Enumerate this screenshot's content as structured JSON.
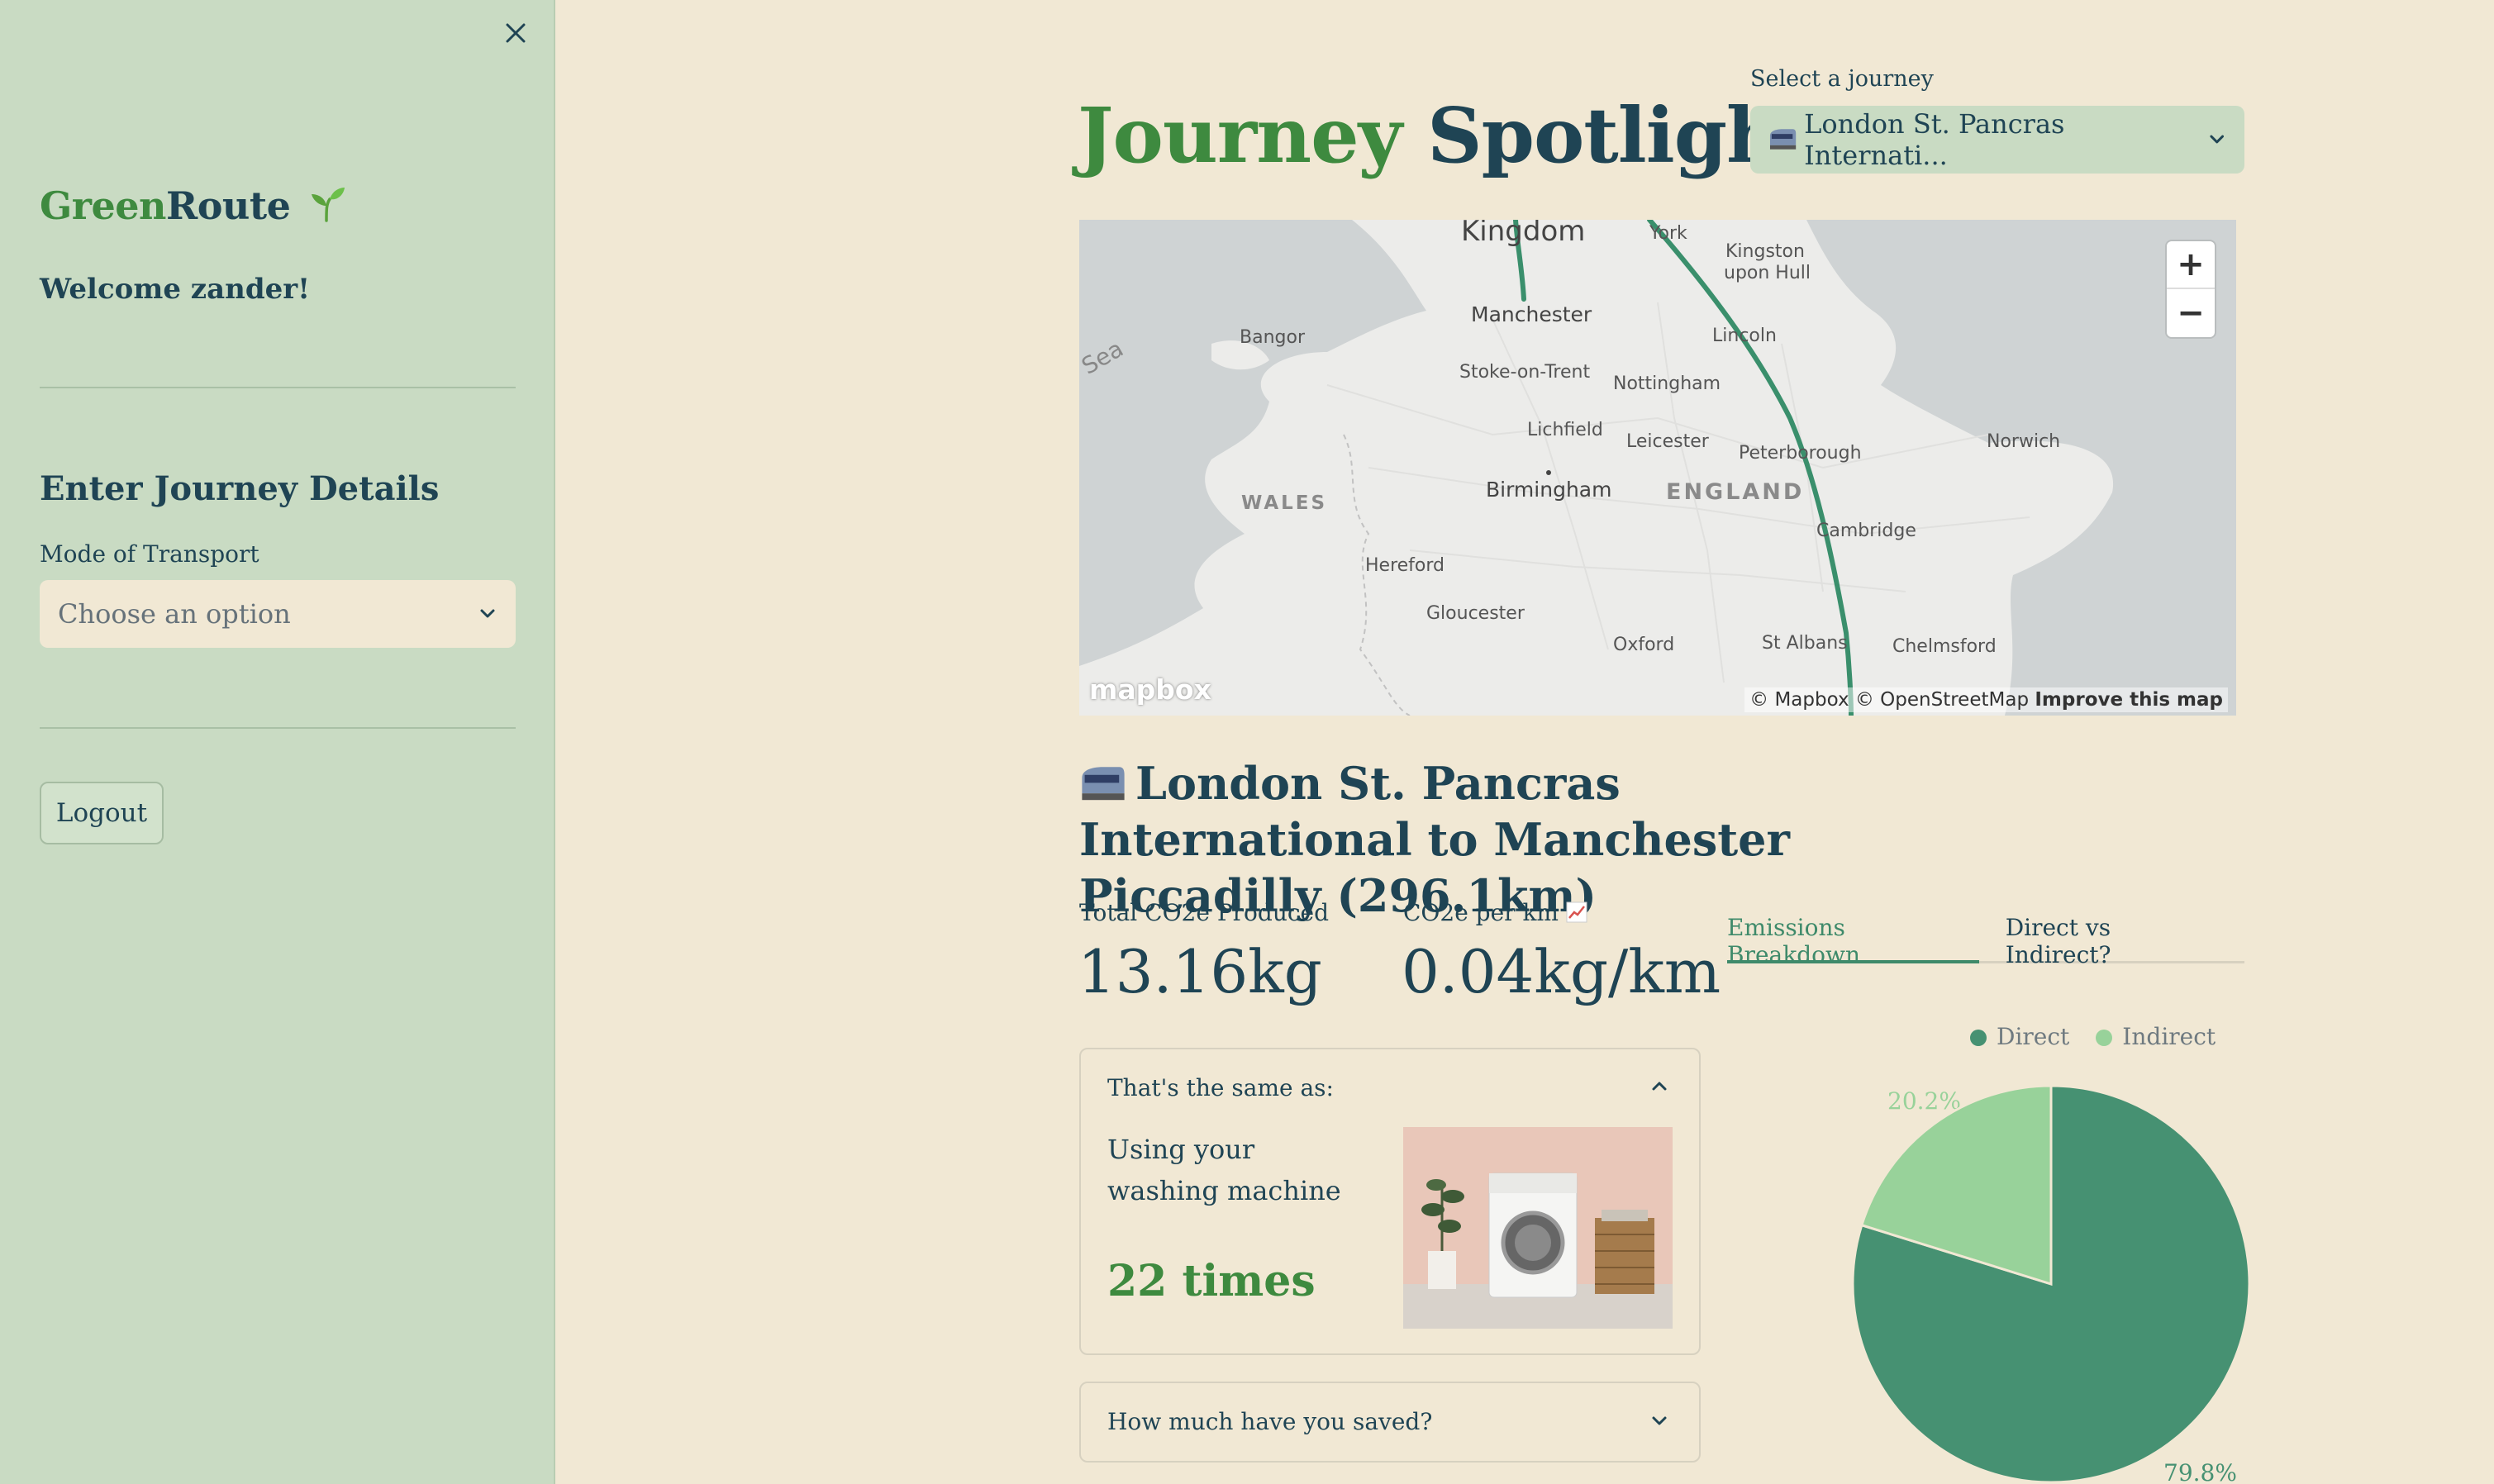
{
  "sidebar": {
    "brand_green": "Green",
    "brand_route": "Route",
    "welcome": "Welcome zander!",
    "section_title": "Enter Journey Details",
    "mode_label": "Mode of Transport",
    "mode_placeholder": "Choose an option",
    "logout": "Logout"
  },
  "header": {
    "title_part1": "Journey",
    "title_part2": "Spotlight",
    "journey_label": "Select a journey",
    "journey_selected": "London St. Pancras Internati..."
  },
  "map": {
    "labels": {
      "kingdom": "Kingdom",
      "york": "York",
      "kingston": "Kingston",
      "upon_hull": "upon Hull",
      "manchester": "Manchester",
      "bangor": "Bangor",
      "sea": "Sea",
      "lincoln": "Lincoln",
      "stoke": "Stoke-on-Trent",
      "nottingham": "Nottingham",
      "lichfield": "Lichfield",
      "leicester": "Leicester",
      "peterborough": "Peterborough",
      "norwich": "Norwich",
      "birmingham": "Birmingham",
      "england": "ENGLAND",
      "wales": "WALES",
      "cambridge": "Cambridge",
      "hereford": "Hereford",
      "gloucester": "Gloucester",
      "oxford": "Oxford",
      "st_albans": "St Albans",
      "chelmsford": "Chelmsford"
    },
    "zoom_in": "+",
    "zoom_out": "−",
    "attribution": "© Mapbox © OpenStreetMap",
    "improve": "Improve this map",
    "logo": "mapbox",
    "route_color": "#3a8f6c"
  },
  "route": {
    "title": "London St. Pancras International to Manchester Piccadilly (296.1km)",
    "icon": "train-icon"
  },
  "stats": {
    "total_label": "Total CO2e Produced",
    "total_value": "13.16kg",
    "per_km_label": "CO2e per km",
    "per_km_icon": "chart-icon",
    "per_km_value": "0.04kg/km"
  },
  "equivalent": {
    "head": "That's the same as:",
    "description": "Using your washing machine",
    "times": "22 times",
    "image": "washing-machine-photo"
  },
  "saved": {
    "head": "How much have you saved?"
  },
  "tabs": [
    {
      "label": "Emissions Breakdown",
      "active": true
    },
    {
      "label": "Direct vs Indirect?",
      "active": false
    }
  ],
  "chart_data": {
    "type": "pie",
    "categories": [
      "Direct",
      "Indirect"
    ],
    "values": [
      79.8,
      20.2
    ],
    "labels": [
      "79.8%",
      "20.2%"
    ],
    "colors": [
      "#469172",
      "#98d29a"
    ],
    "legend": "top"
  },
  "colors": {
    "sidebar_bg": "#c9dbc3",
    "page_bg": "#f1e8d4",
    "brand_green": "#3e8a3f",
    "navy": "#1f4454"
  }
}
